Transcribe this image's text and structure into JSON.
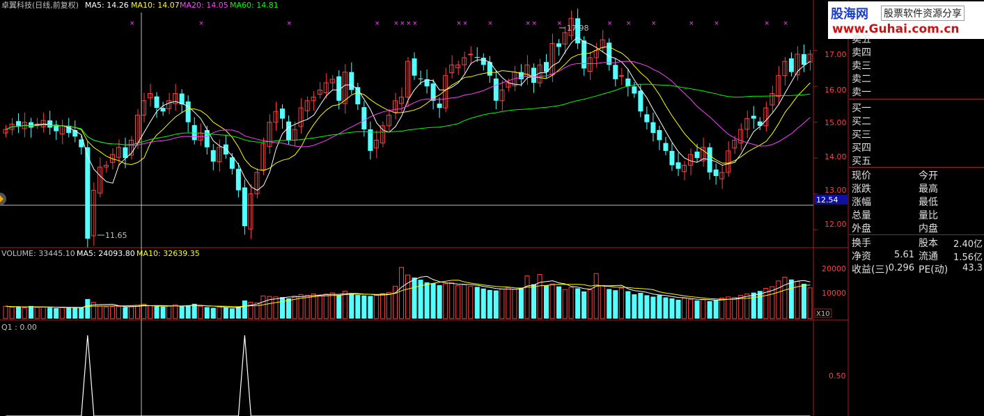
{
  "header": {
    "title": "卓翼科技(日线,前复权)",
    "ma5": "MA5: 14.26",
    "ma10": "MA10: 14.07",
    "ma20": "MA20: 14.05",
    "ma60": "MA60: 14.81"
  },
  "volume_header": {
    "volume": "VOLUME: 33445.10",
    "ma5": "MA5: 24093.80",
    "ma10": "MA10: 32639.35"
  },
  "indicator_header": "Q1 : 0.00",
  "annotations": {
    "high_label": "17.98",
    "low_label": "11.65",
    "price_marker": "12.54",
    "volume_multiplier": "X10"
  },
  "price_axis": [
    "17.00",
    "16.00",
    "15.00",
    "14.00",
    "13.00",
    "12.00"
  ],
  "volume_axis": [
    "20000",
    "10000"
  ],
  "indicator_axis": [
    "0.50"
  ],
  "colors": {
    "up": "#ff4040",
    "down": "#54ffff",
    "ma5": "#ffffff",
    "ma10": "#ffff00",
    "ma20": "#ff40ff",
    "ma60": "#00ff00",
    "grid": "#a02020"
  },
  "logo": {
    "brand": "股海网",
    "slogan": "股票软件资源分享",
    "url": "www.Guhai.com.cn"
  },
  "quote_panel": {
    "sell": [
      "卖五",
      "卖四",
      "卖三",
      "卖二",
      "卖一"
    ],
    "buy": [
      "买一",
      "买二",
      "买三",
      "买四",
      "买五"
    ],
    "grid_left": [
      "现价",
      "涨跌",
      "涨幅",
      "总量",
      "外盘"
    ],
    "grid_right": [
      "今开",
      "最高",
      "最低",
      "量比",
      "内盘"
    ],
    "stats": [
      {
        "label": "换手",
        "value": "",
        "label2": "股本",
        "value2": "2.40亿"
      },
      {
        "label": "净资",
        "value": "5.61",
        "label2": "流通",
        "value2": "1.56亿"
      },
      {
        "label": "收益(三)",
        "value": "0.296",
        "label2": "PE(动)",
        "value2": "43.3"
      }
    ]
  },
  "chart_data": {
    "type": "candlestick",
    "ylim": [
      11.5,
      18.1
    ],
    "ma_lines": [
      "MA5",
      "MA10",
      "MA20",
      "MA60"
    ],
    "closes": [
      14.8,
      14.95,
      14.9,
      15.0,
      14.85,
      14.95,
      15.05,
      14.85,
      14.75,
      14.9,
      14.7,
      14.6,
      14.3,
      11.75,
      13.1,
      13.75,
      13.8,
      14.1,
      14.3,
      14.0,
      14.5,
      15.2,
      15.6,
      15.8,
      15.4,
      15.3,
      15.6,
      15.8,
      15.5,
      15.0,
      14.5,
      14.7,
      14.3,
      13.9,
      14.3,
      14.1,
      13.7,
      13.1,
      12.1,
      13.0,
      13.6,
      14.4,
      15.0,
      15.3,
      15.1,
      14.5,
      14.8,
      15.4,
      15.6,
      15.7,
      15.9,
      16.1,
      16.2,
      15.6,
      16.4,
      15.9,
      15.5,
      14.8,
      14.2,
      14.5,
      14.9,
      15.2,
      15.6,
      15.7,
      16.7,
      16.3,
      16.2,
      16.0,
      15.6,
      15.4,
      16.3,
      16.6,
      16.6,
      16.8,
      16.9,
      16.8,
      16.6,
      16.3,
      15.6,
      15.9,
      16.1,
      16.4,
      16.2,
      16.6,
      16.1,
      16.6,
      16.4,
      17.2,
      17.1,
      17.5,
      17.9,
      17.2,
      16.5,
      16.8,
      17.0,
      17.3,
      16.6,
      16.2,
      16.3,
      16.0,
      15.8,
      15.3,
      15.0,
      14.7,
      14.5,
      14.2,
      13.8,
      13.7,
      13.8,
      14.1,
      14.0,
      14.3,
      13.6,
      13.5,
      13.6,
      14.2,
      14.5,
      14.8,
      15.1,
      15.1,
      14.9,
      15.4,
      15.8,
      16.3,
      16.7,
      16.4,
      16.9,
      16.6,
      16.9
    ],
    "volumes": [
      5200,
      4800,
      5000,
      4500,
      5300,
      4700,
      4900,
      4600,
      4400,
      4800,
      4600,
      4500,
      4700,
      8200,
      6800,
      5200,
      4900,
      5000,
      5100,
      4800,
      5200,
      5600,
      6100,
      5400,
      5100,
      5000,
      5300,
      5800,
      5100,
      5600,
      6200,
      5200,
      4800,
      4500,
      4700,
      4600,
      4200,
      5000,
      7600,
      6900,
      6600,
      9500,
      9300,
      9100,
      9000,
      8500,
      9500,
      10100,
      9800,
      10400,
      9600,
      10300,
      10800,
      9800,
      11500,
      10500,
      9900,
      9700,
      9500,
      9800,
      10500,
      11000,
      13600,
      21500,
      18300,
      17200,
      16300,
      15200,
      14800,
      14000,
      14600,
      15100,
      13900,
      14200,
      13500,
      13300,
      12600,
      12000,
      11800,
      12400,
      13000,
      12300,
      12900,
      17900,
      14400,
      18500,
      14000,
      14600,
      13500,
      12200,
      13100,
      12700,
      11400,
      12100,
      18900,
      13900,
      12400,
      11900,
      12800,
      11500,
      10200,
      10800,
      9800,
      9200,
      9800,
      8900,
      8500,
      7900,
      8600,
      8100,
      7600,
      7900,
      7300,
      7800,
      8600,
      9100,
      8900,
      9800,
      10400,
      10900,
      11600,
      12700,
      13400,
      15800,
      17400,
      16400,
      15600,
      14600,
      12900
    ],
    "indicator_peaks": [
      13,
      38
    ]
  }
}
